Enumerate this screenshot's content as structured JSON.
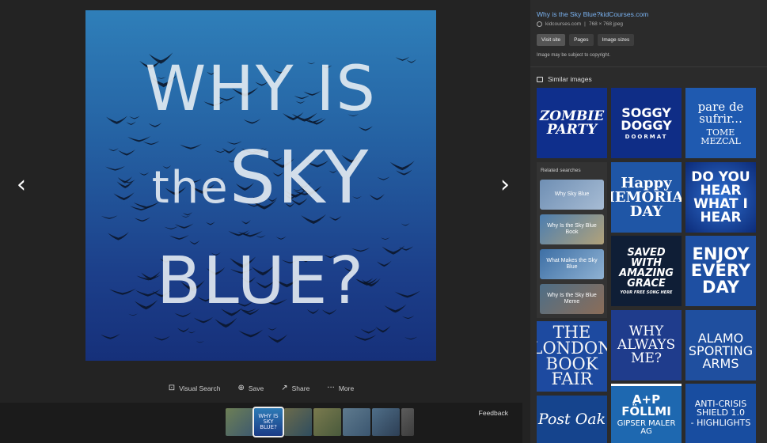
{
  "main_image": {
    "line1": "WHY IS",
    "line2a": "the",
    "line2b": "SKY",
    "line3": "BLUE?"
  },
  "nav": {
    "prev": "‹",
    "next": "›"
  },
  "actions": [
    {
      "icon": "visual-search-icon",
      "glyph": "⊡",
      "label": "Visual Search"
    },
    {
      "icon": "save-icon",
      "glyph": "⊕",
      "label": "Save"
    },
    {
      "icon": "share-icon",
      "glyph": "↗",
      "label": "Share"
    },
    {
      "icon": "more-icon",
      "glyph": "···",
      "label": "More"
    }
  ],
  "filmstrip": {
    "feedback": "Feedback",
    "active_thumb": {
      "line1": "WHY IS",
      "line2": "SKY",
      "line3": "BLUE?"
    }
  },
  "details": {
    "title": "Why is the Sky Blue?kidCourses.com",
    "domain": "kidcourses.com",
    "separator": "|",
    "info": "768 × 768 jpeg",
    "buttons": [
      "Visit site",
      "Pages",
      "Image sizes"
    ],
    "copyright": "Image may be subject to copyright."
  },
  "similar": {
    "header": "Similar images",
    "tiles": [
      {
        "text": "ZOMBIE PARTY"
      },
      {
        "text": "SOGGY DOGGY",
        "sub": "DOORMAT"
      },
      {
        "text": "pare de sufrir...",
        "sub": "TOME MEZCAL"
      },
      {
        "text": "Happy MEMORIAL DAY"
      },
      {
        "text": "DO YOU HEAR WHAT I HEAR"
      },
      {
        "text": "SAVED WITH AMAZING GRACE",
        "sub": "YOUR FREE SONG HERE"
      },
      {
        "text": "ENJOY EVERY DAY"
      },
      {
        "text": "THE LONDON BOOK FAIR"
      },
      {
        "text": "WHY ALWAYS ME?"
      },
      {
        "text": "ALAMO SPORTING ARMS"
      },
      {
        "text": "Post Oak"
      },
      {
        "text": "A+P FÖLLMI",
        "sub": "GIPSER MALER AG"
      },
      {
        "text": "ANTI-CRISIS SHIELD 1.0",
        "sub": "- HIGHLIGHTS"
      }
    ]
  },
  "related": {
    "title": "Related searches",
    "items": [
      "Why Sky Blue",
      "Why Is the Sky Blue Book",
      "What Makes the Sky Blue",
      "Why Is the Sky Blue Meme"
    ]
  },
  "colors": {
    "link": "#7ab2f0",
    "sky_top": "#2f7fb9",
    "sky_bottom": "#16307a"
  }
}
